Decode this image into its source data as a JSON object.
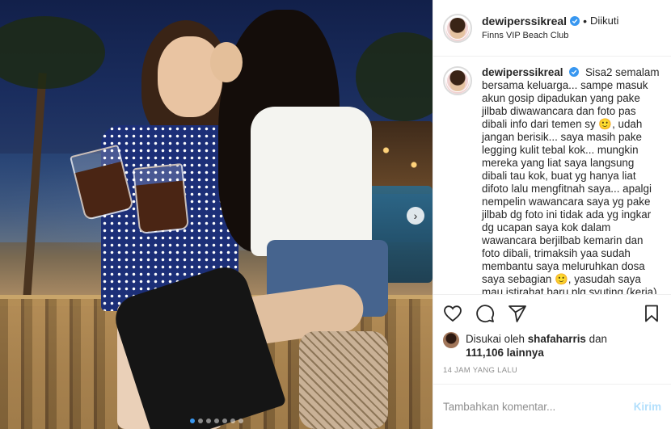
{
  "header": {
    "username": "dewiperssikreal",
    "separator": "•",
    "follow_label": "Diikuti",
    "location": "Finns VIP Beach Club",
    "more_label": "•••"
  },
  "caption": {
    "username": "dewiperssikreal",
    "text": "Sisa2 semalam bersama keluarga... sampe masuk akun gosip dipadukan yang pake jilbab diwawancara dan foto pas dibali info dari temen sy 🙂, udah jangan berisik... saya masih pake legging kulit tebal kok... mungkin mereka yang liat saya langsung dibali tau kok, buat yg hanya liat difoto lalu mengfitnah saya... apalgi nempelin wawancara saya yg pake jilbab dg foto ini tidak ada yg ingkar dg ucapan saya kok dalam wawancara berjilbab kemarin dan foto dibali, trimaksih yaa sudah membantu saya meluruhkan dosa saya sebagian 🙂, yasudah saya mau istirahat baru plg syuting (kerja) jangan lupa nikmatin hidup"
  },
  "likes": {
    "prefix": "Disukai oleh",
    "liker": "shafaharris",
    "middle": "dan",
    "count": "111,106",
    "suffix": "lainnya"
  },
  "timestamp": "14 JAM YANG LALU",
  "comment": {
    "placeholder": "Tambahkan komentar...",
    "post_label": "Kirim"
  },
  "media": {
    "nav_next": "›",
    "carousel": {
      "count": 7,
      "active_index": 0
    }
  },
  "colors": {
    "verified": "#3897f0",
    "border": "#efefef",
    "muted": "#8e8e8e",
    "post_disabled": "#b2dffc"
  },
  "icons": [
    "verified-badge-icon",
    "heart-icon",
    "comment-icon",
    "share-icon",
    "bookmark-icon",
    "chevron-right-icon"
  ]
}
